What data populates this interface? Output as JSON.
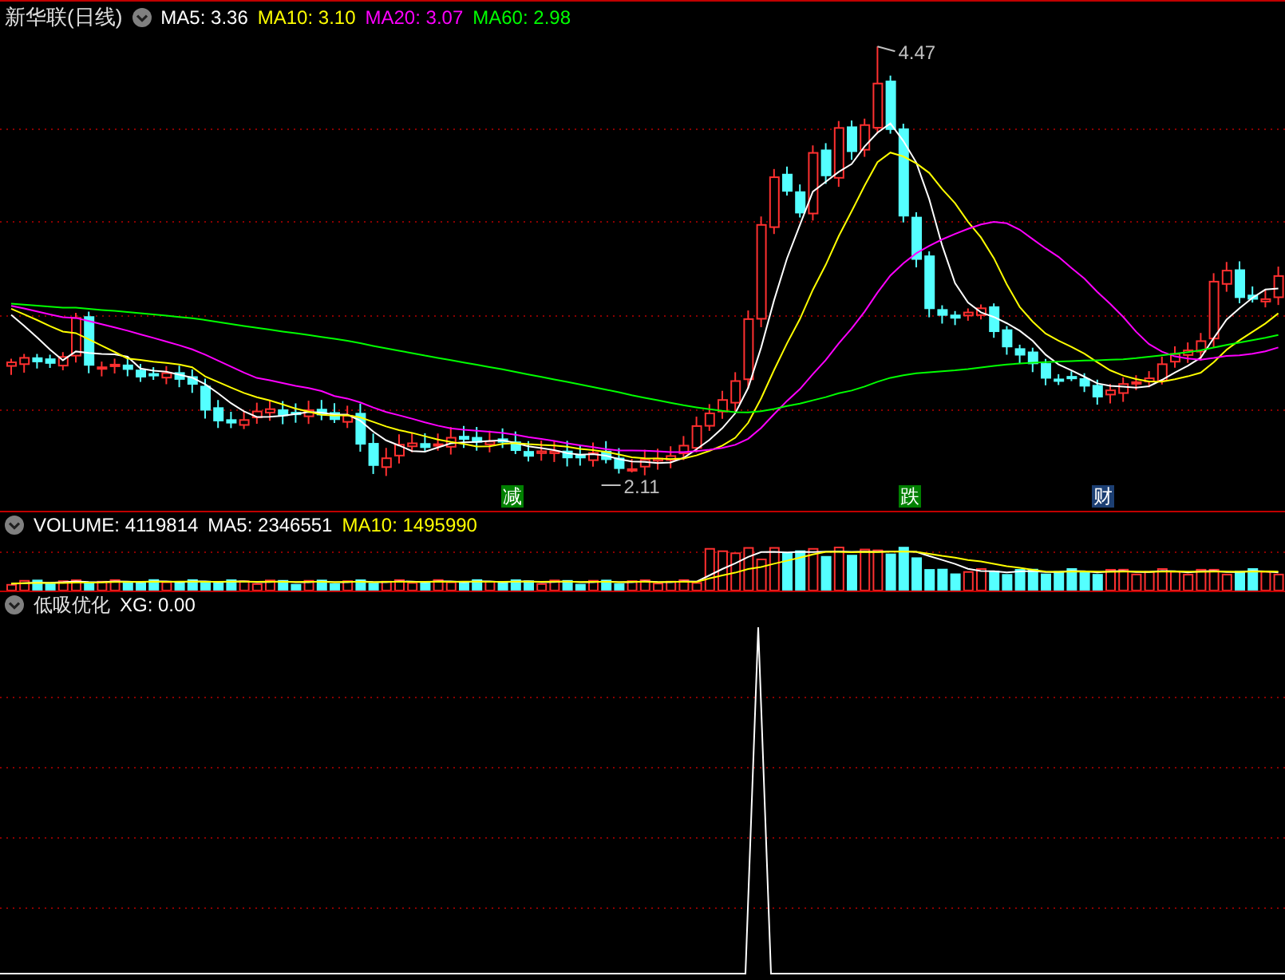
{
  "main_panel": {
    "title": "新华联(日线)",
    "indicators": [
      {
        "label": "MA5: 3.36",
        "color": "#ffffff"
      },
      {
        "label": "MA10: 3.10",
        "color": "#ffff00"
      },
      {
        "label": "MA20: 3.07",
        "color": "#ff00ff"
      },
      {
        "label": "MA60: 2.98",
        "color": "#00ff00"
      }
    ],
    "high_label": "4.47",
    "low_label": "2.11",
    "event_markers": [
      {
        "text": "减",
        "color": "#008000"
      },
      {
        "text": "跌",
        "color": "#008000"
      },
      {
        "text": "财",
        "color": "#1c3f73"
      }
    ]
  },
  "volume_panel": {
    "indicators": [
      {
        "label": "VOLUME: 4119814",
        "color": "#ffffff"
      },
      {
        "label": "MA5: 2346551",
        "color": "#ffffff"
      },
      {
        "label": "MA10: 1495990",
        "color": "#ffff00"
      }
    ]
  },
  "signal_panel": {
    "title": "低吸优化",
    "indicators": [
      {
        "label": "XG: 0.00",
        "color": "#ffffff"
      }
    ]
  }
}
